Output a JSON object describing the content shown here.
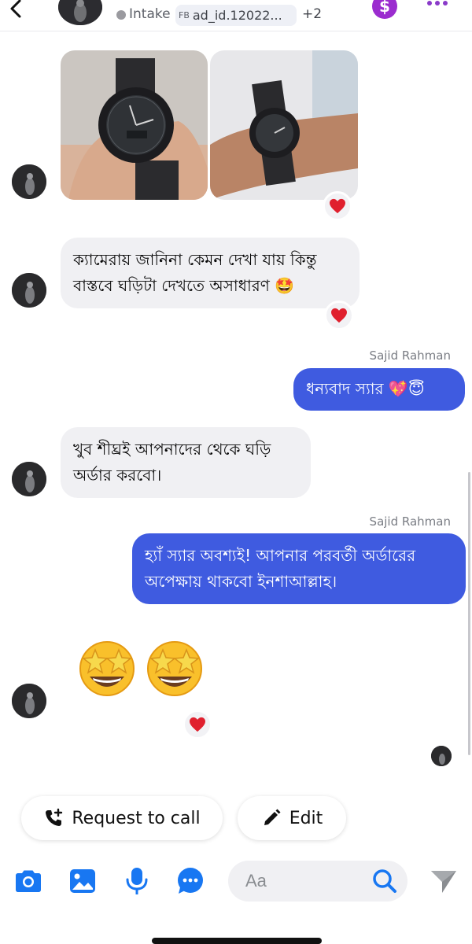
{
  "header": {
    "status_label": "Intake",
    "ad_prefix": "FB",
    "ad_id": "ad_id.12022...",
    "extra_count": "+2",
    "dollar_symbol": "$"
  },
  "messages": [
    {
      "type": "image_pair",
      "direction": "incoming",
      "reaction": "heart"
    },
    {
      "type": "text",
      "direction": "incoming",
      "text_line1": "ক্যামেরায় জানিনা কেমন দেখা যায় কিন্তু",
      "text_line2": "বাস্তবে ঘড়িটা দেখতে অসাধারণ 🤩",
      "reaction": "heart"
    },
    {
      "type": "text",
      "direction": "outgoing",
      "sender": "Sajid Rahman",
      "text": "ধন্যবাদ স্যার 💖😇"
    },
    {
      "type": "text",
      "direction": "incoming",
      "text_line1": "খুব শীঘ্রই আপনাদের থেকে ঘড়ি",
      "text_line2": "অর্ডার করবো।"
    },
    {
      "type": "text",
      "direction": "outgoing",
      "sender": "Sajid Rahman",
      "text_line1": "হ্যাঁ স্যার অবশ্যই! আপনার পরবর্তী অর্ডারের",
      "text_line2": "অপেক্ষায় থাকবো ইনশাআল্লাহ।"
    },
    {
      "type": "emoji",
      "direction": "incoming",
      "text": "🤩🤩",
      "reaction": "heart"
    }
  ],
  "actions": {
    "request_call_label": "Request to call",
    "edit_label": "Edit"
  },
  "composer": {
    "placeholder": "Aa"
  },
  "colors": {
    "accent": "#3f5be0",
    "incoming_bubble": "#f0f0f3",
    "heart": "#e0202e",
    "messenger_blue": "#1877f2"
  },
  "icons": [
    "back-chevron-icon",
    "more-dots-icon",
    "dollar-icon",
    "heart-icon",
    "phone-plus-icon",
    "pencil-icon",
    "camera-icon",
    "gallery-icon",
    "microphone-icon",
    "chat-dots-icon",
    "search-icon",
    "send-icon"
  ]
}
